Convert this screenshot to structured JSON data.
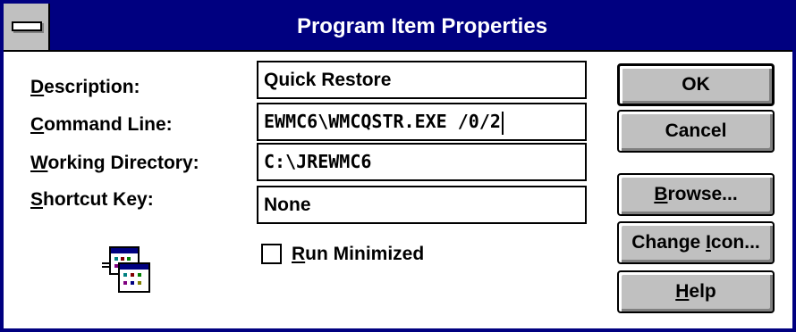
{
  "window": {
    "title": "Program Item Properties"
  },
  "form": {
    "description": {
      "label_key": "D",
      "label_rest": "escription:",
      "value": "Quick Restore"
    },
    "command_line": {
      "label_key": "C",
      "label_rest": "ommand Line:",
      "value": "EWMC6\\WMCQSTR.EXE /0/2"
    },
    "working_directory": {
      "label_key": "W",
      "label_rest": "orking Directory:",
      "value": "C:\\JREWMC6"
    },
    "shortcut_key": {
      "label_key": "S",
      "label_rest": "hortcut Key:",
      "value": "None"
    },
    "run_minimized": {
      "label_key": "R",
      "label_rest": "un Minimized",
      "checked": false
    }
  },
  "buttons": {
    "ok": {
      "label": "OK"
    },
    "cancel": {
      "label": "Cancel"
    },
    "browse": {
      "label_key": "B",
      "label_rest": "rowse..."
    },
    "change_icon": {
      "label_pre": "Change ",
      "label_key": "I",
      "label_rest": "con..."
    },
    "help": {
      "label_key": "H",
      "label_rest": "elp"
    }
  },
  "icon": {
    "name": "program-group-icon"
  }
}
